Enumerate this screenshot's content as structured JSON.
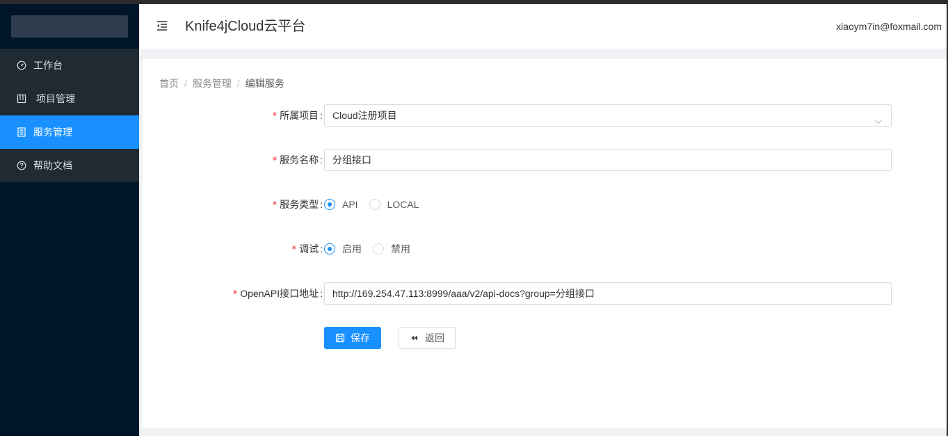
{
  "header": {
    "title": "Knife4jCloud云平台",
    "user_email": "xiaoym7in@foxmail.com"
  },
  "sidebar": {
    "items": [
      {
        "label": "工作台",
        "icon": "dashboard-icon",
        "active": false
      },
      {
        "label": "项目管理",
        "icon": "project-icon",
        "active": false
      },
      {
        "label": "服务管理",
        "icon": "service-icon",
        "active": true
      },
      {
        "label": "帮助文档",
        "icon": "help-icon",
        "active": false
      }
    ]
  },
  "breadcrumb": {
    "home": "首页",
    "section": "服务管理",
    "current": "编辑服务",
    "separator": "/"
  },
  "form": {
    "project": {
      "label": "所属项目",
      "value": "Cloud注册项目"
    },
    "service_name": {
      "label": "服务名称",
      "value": "分组接口"
    },
    "service_type": {
      "label": "服务类型",
      "options": [
        "API",
        "LOCAL"
      ],
      "selected": "API"
    },
    "debug": {
      "label": "调试",
      "options": [
        "启用",
        "禁用"
      ],
      "selected": "启用"
    },
    "openapi": {
      "label": "OpenAPI接口地址",
      "value": "http://169.254.47.113:8999/aaa/v2/api-docs?group=分组接口"
    },
    "required_mark": "*",
    "colon": ":"
  },
  "actions": {
    "save_label": "保存",
    "back_label": "返回"
  },
  "colors": {
    "sidebar_bg": "#001529",
    "accent": "#1890ff",
    "required": "#f5222d"
  }
}
